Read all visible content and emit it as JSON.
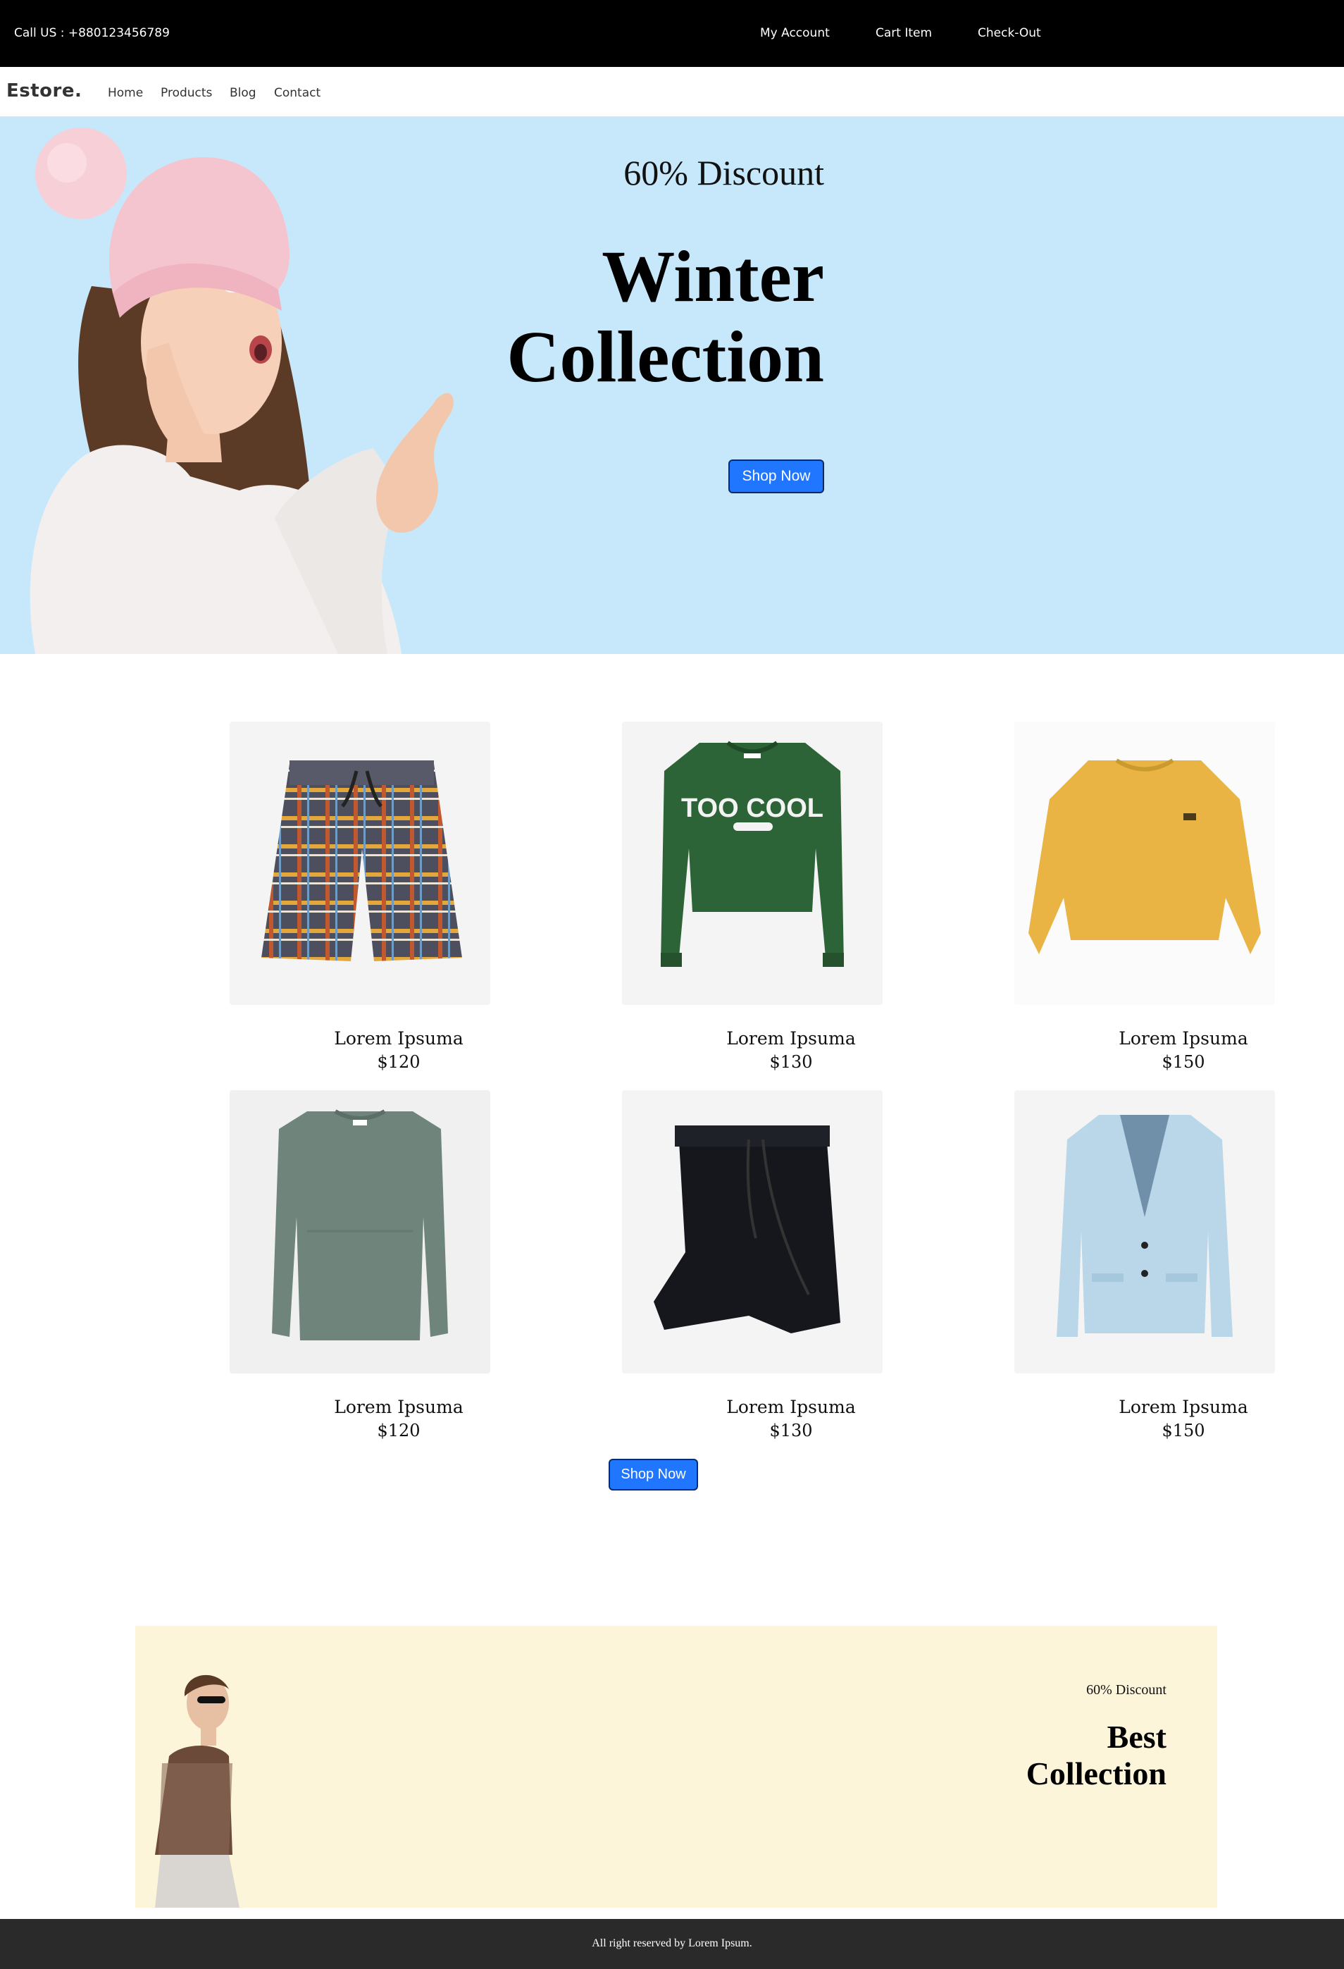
{
  "topbar": {
    "call": "Call US : +880123456789",
    "links": [
      "My Account",
      "Cart Item",
      "Check-Out"
    ]
  },
  "nav": {
    "brand": "Estore.",
    "links": [
      "Home",
      "Products",
      "Blog",
      "Contact"
    ]
  },
  "hero": {
    "discount": "60% Discount",
    "title_line1": "Winter",
    "title_line2": "Collection",
    "button": "Shop Now"
  },
  "products": [
    {
      "name": "Lorem Ipsuma",
      "price": "$120",
      "image": "plaid-shorts"
    },
    {
      "name": "Lorem Ipsuma",
      "price": "$130",
      "image": "green-sweatshirt"
    },
    {
      "name": "Lorem Ipsuma",
      "price": "$150",
      "image": "yellow-sweater"
    },
    {
      "name": "Lorem Ipsuma",
      "price": "$120",
      "image": "grey-sweater"
    },
    {
      "name": "Lorem Ipsuma",
      "price": "$130",
      "image": "black-pants"
    },
    {
      "name": "Lorem Ipsuma",
      "price": "$150",
      "image": "denim-blazer"
    }
  ],
  "products_button": "Shop Now",
  "promo": {
    "discount": "60% Discount",
    "title_line1": "Best",
    "title_line2": "Collection"
  },
  "footer": {
    "copyright": "All right reserved by Lorem Ipsum."
  },
  "colors": {
    "topbar": "#000000",
    "hero_bg": "#c7e8fb",
    "button": "#2176ff",
    "promo_bg": "#fdf5d9",
    "footer": "#2a2a2a"
  }
}
